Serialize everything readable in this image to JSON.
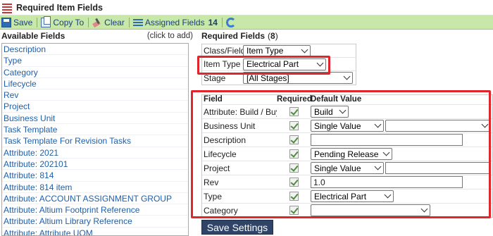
{
  "window": {
    "title": "Required Item Fields"
  },
  "toolbar": {
    "save": "Save",
    "copy_to": "Copy To",
    "clear": "Clear",
    "assigned_fields": "Assigned Fields",
    "assigned_count": "14"
  },
  "left": {
    "heading": "Available Fields",
    "hint": "(click to add)",
    "items": [
      "Description",
      "Type",
      "Category",
      "Lifecycle",
      "Rev",
      "Project",
      "Business Unit",
      "Task Template",
      "Task Template For Revision Tasks",
      "Attribute: 2021",
      "Attribute: 202101",
      "Attribute: 814",
      "Attribute: 814 item",
      "Attribute: ACCOUNT ASSIGNMENT GROUP",
      "Attribute: Altium Footprint Reference",
      "Attribute: Altium Library Reference",
      "Attribute: Attribute UOM"
    ]
  },
  "right": {
    "heading": "Required Fields",
    "count": "8",
    "filters": {
      "class_field_label": "Class/Field",
      "class_field_value": "Item Type",
      "item_type_label": "Item Type",
      "item_type_value": "Electrical Part",
      "stage_label": "Stage",
      "stage_value": "[All Stages]"
    },
    "fields_header": {
      "field": "Field",
      "required": "Required",
      "default": "Default Value"
    },
    "fields": [
      {
        "name": "Attribute: Build / Buy",
        "default": "Build"
      },
      {
        "name": "Business Unit",
        "default": "Single Value",
        "extra": ""
      },
      {
        "name": "Description",
        "default": ""
      },
      {
        "name": "Lifecycle",
        "default": "Pending Release"
      },
      {
        "name": "Project",
        "default": "Single Value",
        "extra": ""
      },
      {
        "name": "Rev",
        "default": "1.0"
      },
      {
        "name": "Type",
        "default": "Electrical Part"
      },
      {
        "name": "Category",
        "default": ""
      }
    ],
    "save_settings": "Save Settings"
  },
  "colors": {
    "toolbar_bg": "#c7e8a8",
    "highlight": "#e0252b",
    "link": "#1f5fa8",
    "button": "#2f4466"
  }
}
